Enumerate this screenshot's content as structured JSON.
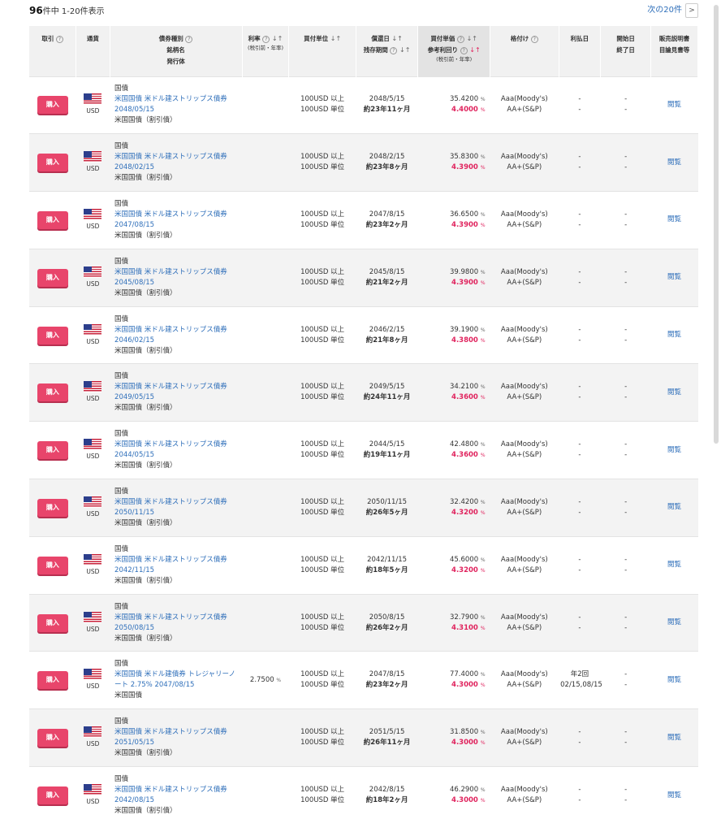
{
  "summary": {
    "total": "96",
    "total_suffix": "件中 1-20件表示",
    "next_label": "次の20件",
    "next_arrow": ">"
  },
  "headers": {
    "trade": "取引",
    "currency": "通貨",
    "bond_type": "債券種別",
    "bond_name": "銘柄名",
    "issuer": "発行体",
    "rate": "利率",
    "rate_note": "(税引前・年率)",
    "unit": "買付単位",
    "redemption": "償還日",
    "remaining": "残存期間",
    "price": "買付単価",
    "yield": "参考利回り",
    "yield_note": "(税引前・年率)",
    "rating": "格付け",
    "interest_date": "利払日",
    "start": "開始日",
    "end": "終了日",
    "doc1": "販売説明書",
    "doc2": "目論見書等",
    "help_mark": "?",
    "sort_mark": "↓↑"
  },
  "labels": {
    "buy": "購入",
    "view": "閲覧",
    "percent": "%"
  },
  "rows": [
    {
      "currency": "USD",
      "category": "国債",
      "name": "米国国債 米ドル建ストリップス債券 2048/05/15",
      "issuer": "米国国債（割引債）",
      "rate": "",
      "unit1": "100USD 以上",
      "unit2": "100USD 単位",
      "redemption": "2048/5/15",
      "remaining": "約23年11ヶ月",
      "price": "35.4200",
      "yield": "4.4000",
      "rating1": "Aaa(Moody's)",
      "rating2": "AA+(S&P)",
      "pay1": "-",
      "pay2": "-",
      "start": "-",
      "end": "-"
    },
    {
      "currency": "USD",
      "category": "国債",
      "name": "米国国債 米ドル建ストリップス債券 2048/02/15",
      "issuer": "米国国債（割引債）",
      "rate": "",
      "unit1": "100USD 以上",
      "unit2": "100USD 単位",
      "redemption": "2048/2/15",
      "remaining": "約23年8ヶ月",
      "price": "35.8300",
      "yield": "4.3900",
      "rating1": "Aaa(Moody's)",
      "rating2": "AA+(S&P)",
      "pay1": "-",
      "pay2": "-",
      "start": "-",
      "end": "-"
    },
    {
      "currency": "USD",
      "category": "国債",
      "name": "米国国債 米ドル建ストリップス債券 2047/08/15",
      "issuer": "米国国債（割引債）",
      "rate": "",
      "unit1": "100USD 以上",
      "unit2": "100USD 単位",
      "redemption": "2047/8/15",
      "remaining": "約23年2ヶ月",
      "price": "36.6500",
      "yield": "4.3900",
      "rating1": "Aaa(Moody's)",
      "rating2": "AA+(S&P)",
      "pay1": "-",
      "pay2": "-",
      "start": "-",
      "end": "-"
    },
    {
      "currency": "USD",
      "category": "国債",
      "name": "米国国債 米ドル建ストリップス債券 2045/08/15",
      "issuer": "米国国債（割引債）",
      "rate": "",
      "unit1": "100USD 以上",
      "unit2": "100USD 単位",
      "redemption": "2045/8/15",
      "remaining": "約21年2ヶ月",
      "price": "39.9800",
      "yield": "4.3900",
      "rating1": "Aaa(Moody's)",
      "rating2": "AA+(S&P)",
      "pay1": "-",
      "pay2": "-",
      "start": "-",
      "end": "-"
    },
    {
      "currency": "USD",
      "category": "国債",
      "name": "米国国債 米ドル建ストリップス債券 2046/02/15",
      "issuer": "米国国債（割引債）",
      "rate": "",
      "unit1": "100USD 以上",
      "unit2": "100USD 単位",
      "redemption": "2046/2/15",
      "remaining": "約21年8ヶ月",
      "price": "39.1900",
      "yield": "4.3800",
      "rating1": "Aaa(Moody's)",
      "rating2": "AA+(S&P)",
      "pay1": "-",
      "pay2": "-",
      "start": "-",
      "end": "-"
    },
    {
      "currency": "USD",
      "category": "国債",
      "name": "米国国債 米ドル建ストリップス債券 2049/05/15",
      "issuer": "米国国債（割引債）",
      "rate": "",
      "unit1": "100USD 以上",
      "unit2": "100USD 単位",
      "redemption": "2049/5/15",
      "remaining": "約24年11ヶ月",
      "price": "34.2100",
      "yield": "4.3600",
      "rating1": "Aaa(Moody's)",
      "rating2": "AA+(S&P)",
      "pay1": "-",
      "pay2": "-",
      "start": "-",
      "end": "-"
    },
    {
      "currency": "USD",
      "category": "国債",
      "name": "米国国債 米ドル建ストリップス債券 2044/05/15",
      "issuer": "米国国債（割引債）",
      "rate": "",
      "unit1": "100USD 以上",
      "unit2": "100USD 単位",
      "redemption": "2044/5/15",
      "remaining": "約19年11ヶ月",
      "price": "42.4800",
      "yield": "4.3600",
      "rating1": "Aaa(Moody's)",
      "rating2": "AA+(S&P)",
      "pay1": "-",
      "pay2": "-",
      "start": "-",
      "end": "-"
    },
    {
      "currency": "USD",
      "category": "国債",
      "name": "米国国債 米ドル建ストリップス債券 2050/11/15",
      "issuer": "米国国債（割引債）",
      "rate": "",
      "unit1": "100USD 以上",
      "unit2": "100USD 単位",
      "redemption": "2050/11/15",
      "remaining": "約26年5ヶ月",
      "price": "32.4200",
      "yield": "4.3200",
      "rating1": "Aaa(Moody's)",
      "rating2": "AA+(S&P)",
      "pay1": "-",
      "pay2": "-",
      "start": "-",
      "end": "-"
    },
    {
      "currency": "USD",
      "category": "国債",
      "name": "米国国債 米ドル建ストリップス債券 2042/11/15",
      "issuer": "米国国債（割引債）",
      "rate": "",
      "unit1": "100USD 以上",
      "unit2": "100USD 単位",
      "redemption": "2042/11/15",
      "remaining": "約18年5ヶ月",
      "price": "45.6000",
      "yield": "4.3200",
      "rating1": "Aaa(Moody's)",
      "rating2": "AA+(S&P)",
      "pay1": "-",
      "pay2": "-",
      "start": "-",
      "end": "-"
    },
    {
      "currency": "USD",
      "category": "国債",
      "name": "米国国債 米ドル建ストリップス債券 2050/08/15",
      "issuer": "米国国債（割引債）",
      "rate": "",
      "unit1": "100USD 以上",
      "unit2": "100USD 単位",
      "redemption": "2050/8/15",
      "remaining": "約26年2ヶ月",
      "price": "32.7900",
      "yield": "4.3100",
      "rating1": "Aaa(Moody's)",
      "rating2": "AA+(S&P)",
      "pay1": "-",
      "pay2": "-",
      "start": "-",
      "end": "-"
    },
    {
      "currency": "USD",
      "category": "国債",
      "name": "米国国債 米ドル建債券 トレジャリーノート 2.75% 2047/08/15",
      "issuer": "米国国債",
      "rate": "2.7500",
      "unit1": "100USD 以上",
      "unit2": "100USD 単位",
      "redemption": "2047/8/15",
      "remaining": "約23年2ヶ月",
      "price": "77.4000",
      "yield": "4.3000",
      "rating1": "Aaa(Moody's)",
      "rating2": "AA+(S&P)",
      "pay1": "年2回",
      "pay2": "02/15,08/15",
      "start": "-",
      "end": "-"
    },
    {
      "currency": "USD",
      "category": "国債",
      "name": "米国国債 米ドル建ストリップス債券 2051/05/15",
      "issuer": "米国国債（割引債）",
      "rate": "",
      "unit1": "100USD 以上",
      "unit2": "100USD 単位",
      "redemption": "2051/5/15",
      "remaining": "約26年11ヶ月",
      "price": "31.8500",
      "yield": "4.3000",
      "rating1": "Aaa(Moody's)",
      "rating2": "AA+(S&P)",
      "pay1": "-",
      "pay2": "-",
      "start": "-",
      "end": "-"
    },
    {
      "currency": "USD",
      "category": "国債",
      "name": "米国国債 米ドル建ストリップス債券 2042/08/15",
      "issuer": "米国国債（割引債）",
      "rate": "",
      "unit1": "100USD 以上",
      "unit2": "100USD 単位",
      "redemption": "2042/8/15",
      "remaining": "約18年2ヶ月",
      "price": "46.2900",
      "yield": "4.3000",
      "rating1": "Aaa(Moody's)",
      "rating2": "AA+(S&P)",
      "pay1": "-",
      "pay2": "-",
      "start": "-",
      "end": "-"
    }
  ]
}
